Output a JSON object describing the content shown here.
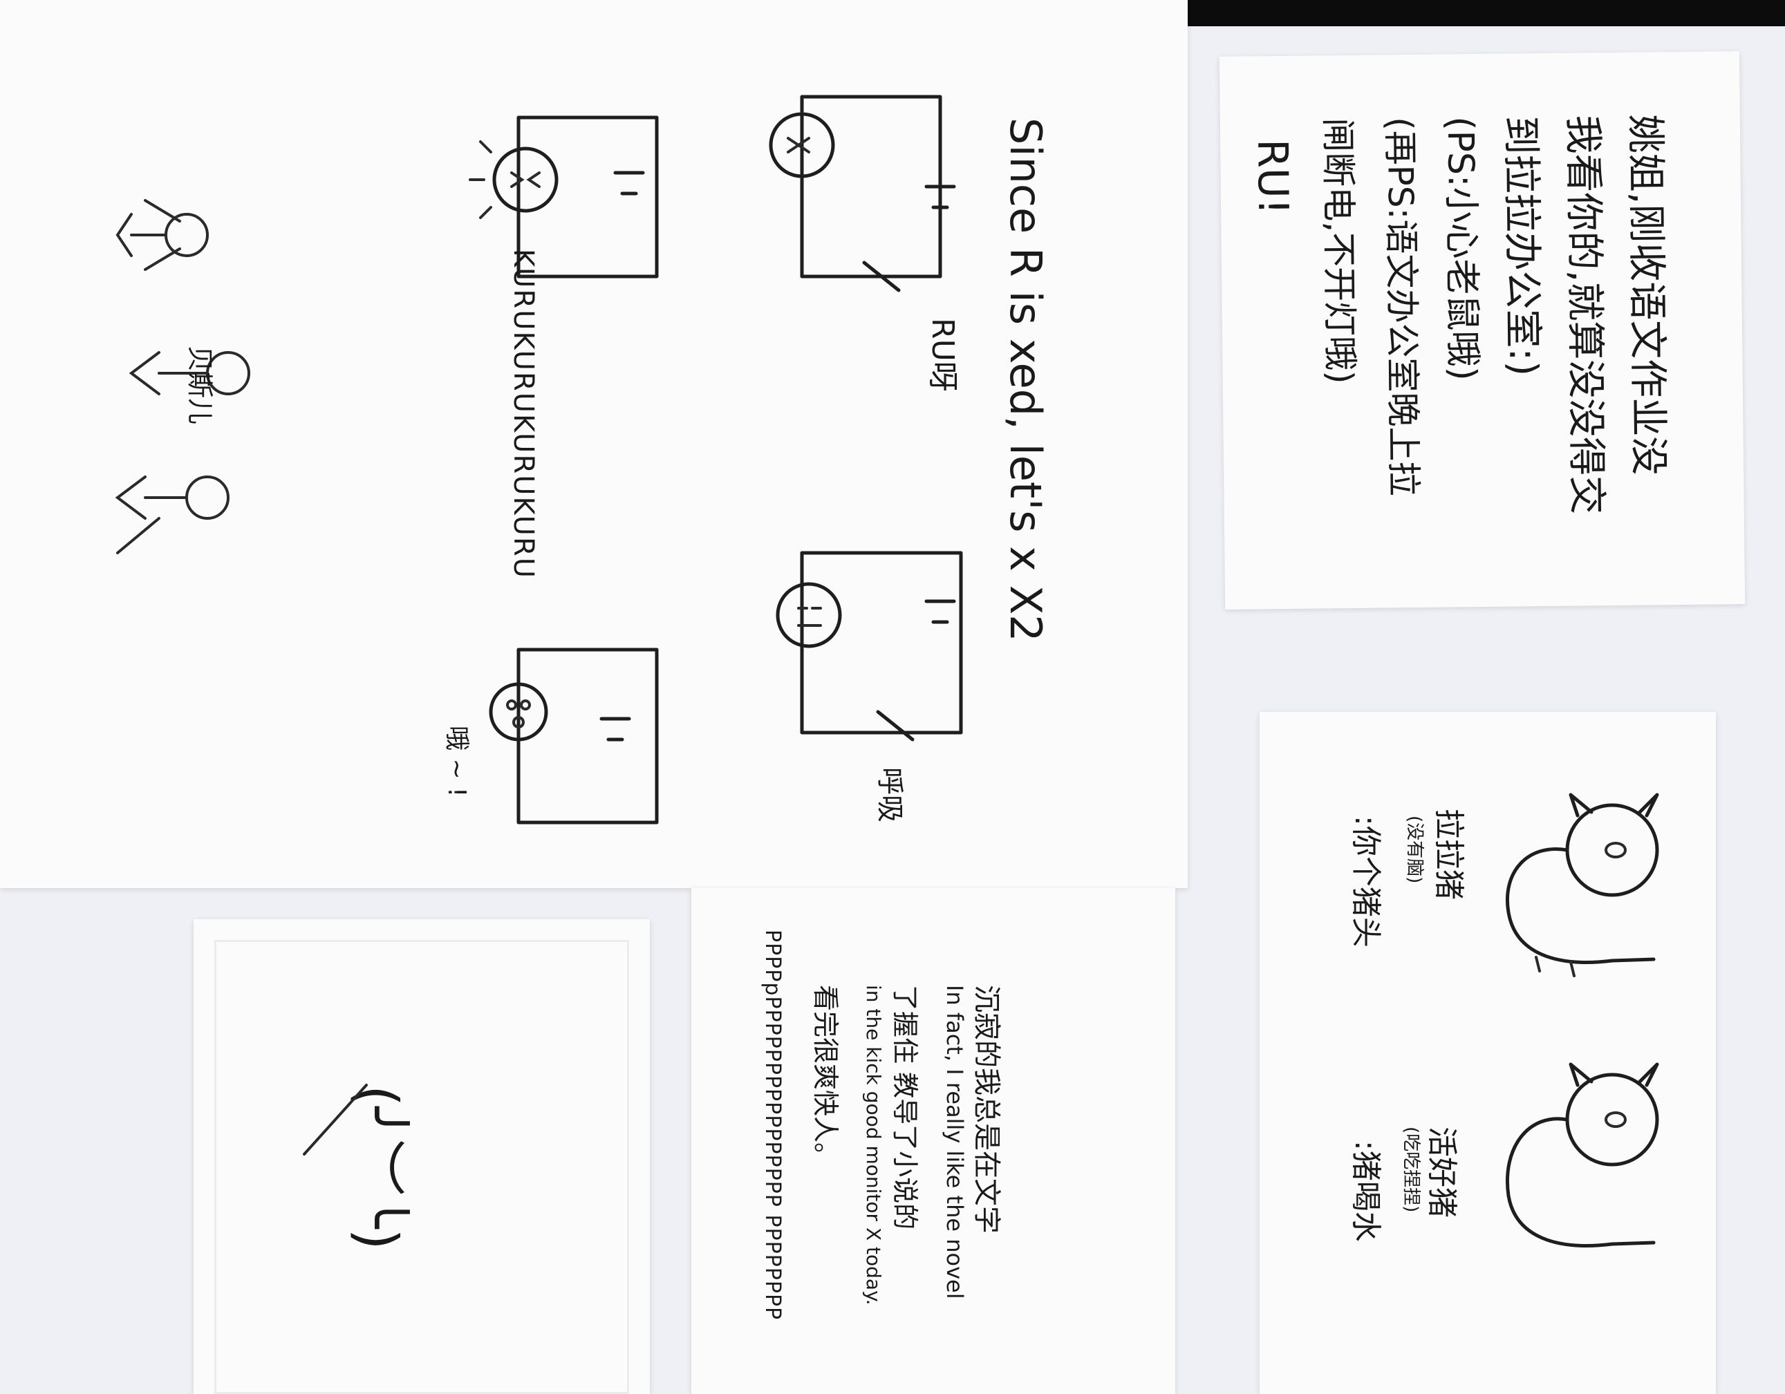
{
  "notes": {
    "big_sheet": {
      "title_line": "Since ",
      "title_mark": "R",
      "title_rest": " is xed, let's x X2",
      "label_ru": "RU呀",
      "label_alive": "呼吸",
      "label_kuru": "KURUKURUKURUKURU",
      "label_ouch": "哦 ~ !",
      "figure_label": "贝斯儿"
    },
    "top_right": {
      "lines": [
        "姚姐,刚收语文作业没",
        "我看你的,就算没没得交",
        "到拉拉办公室:)",
        "(PS:小心老鼠哦)",
        "(再PS:语文办公室晚上拉",
        "闸断电,不开灯哦)",
        "RU!"
      ]
    },
    "pigs": {
      "pig1_name": "拉拉猪",
      "pig1_sub": "(没有脑)",
      "pig1_say": ":你个猪头",
      "pig2_name": "活好猪",
      "pig2_sub": "(吃吃捏捏)",
      "pig2_say": ":猪喝水"
    },
    "middle_bottom": {
      "line1": "沉寂的我总是在文字",
      "line2": "In fact, I really like the novel",
      "line3": "了握住 教导了小说的",
      "line4": "in the kick good monitor X today.",
      "line5": "看完很爽快人。",
      "pp_line": "PPPPpPPPPPPPPPPPPPPPP PPPPPPPP"
    },
    "face_card": {
      "face_text": "(╯︶╰)"
    }
  }
}
